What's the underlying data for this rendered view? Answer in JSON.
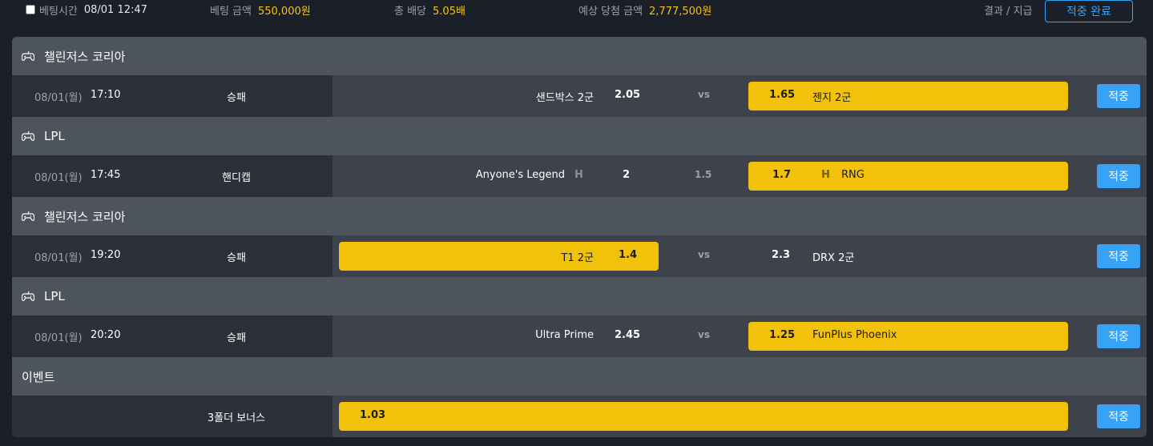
{
  "summary": {
    "bet_time_label": "베팅시간",
    "bet_time_value": "08/01 12:47",
    "bet_amount_label": "베팅 금액",
    "bet_amount_value": "550,000원",
    "total_odds_label": "총 배당",
    "total_odds_value": "5.05배",
    "expected_win_label": "예상 당첨 금액",
    "expected_win_value": "2,777,500원",
    "result_label": "결과 / 지급",
    "status_button": "적중 완료"
  },
  "icons": {
    "league": "gamepad-icon",
    "handicap": "handicap-h-icon",
    "checkbox": "checkbox-icon"
  },
  "colors": {
    "highlight": "#f2c10a",
    "accent": "#36a3f6",
    "gold_text": "#f3c213"
  },
  "sections": [
    {
      "league": "챌린저스 코리아",
      "match": {
        "date": "08/01(월)",
        "time": "17:10",
        "type": "승패",
        "home": "샌드박스 2군",
        "home_odds": "2.05",
        "center": "vs",
        "away_odds": "1.65",
        "away": "젠지 2군",
        "selected": "away",
        "result": "적중"
      }
    },
    {
      "league": "LPL",
      "match": {
        "date": "08/01(월)",
        "time": "17:45",
        "type": "핸디캡",
        "home": "Anyone's Legend",
        "home_odds": "2",
        "center": "1.5",
        "away_odds": "1.7",
        "away": "RNG",
        "selected": "away",
        "result": "적중"
      }
    },
    {
      "league": "챌린저스 코리아",
      "match": {
        "date": "08/01(월)",
        "time": "19:20",
        "type": "승패",
        "home": "T1 2군",
        "home_odds": "1.4",
        "center": "vs",
        "away_odds": "2.3",
        "away": "DRX 2군",
        "selected": "home",
        "result": "적중"
      }
    },
    {
      "league": "LPL",
      "match": {
        "date": "08/01(월)",
        "time": "20:20",
        "type": "승패",
        "home": "Ultra Prime",
        "home_odds": "2.45",
        "center": "vs",
        "away_odds": "1.25",
        "away": "FunPlus Phoenix",
        "selected": "away",
        "result": "적중"
      }
    },
    {
      "league": "이벤트",
      "match": {
        "type": "3폴더 보너스",
        "odds": "1.03",
        "result": "적중"
      }
    }
  ]
}
